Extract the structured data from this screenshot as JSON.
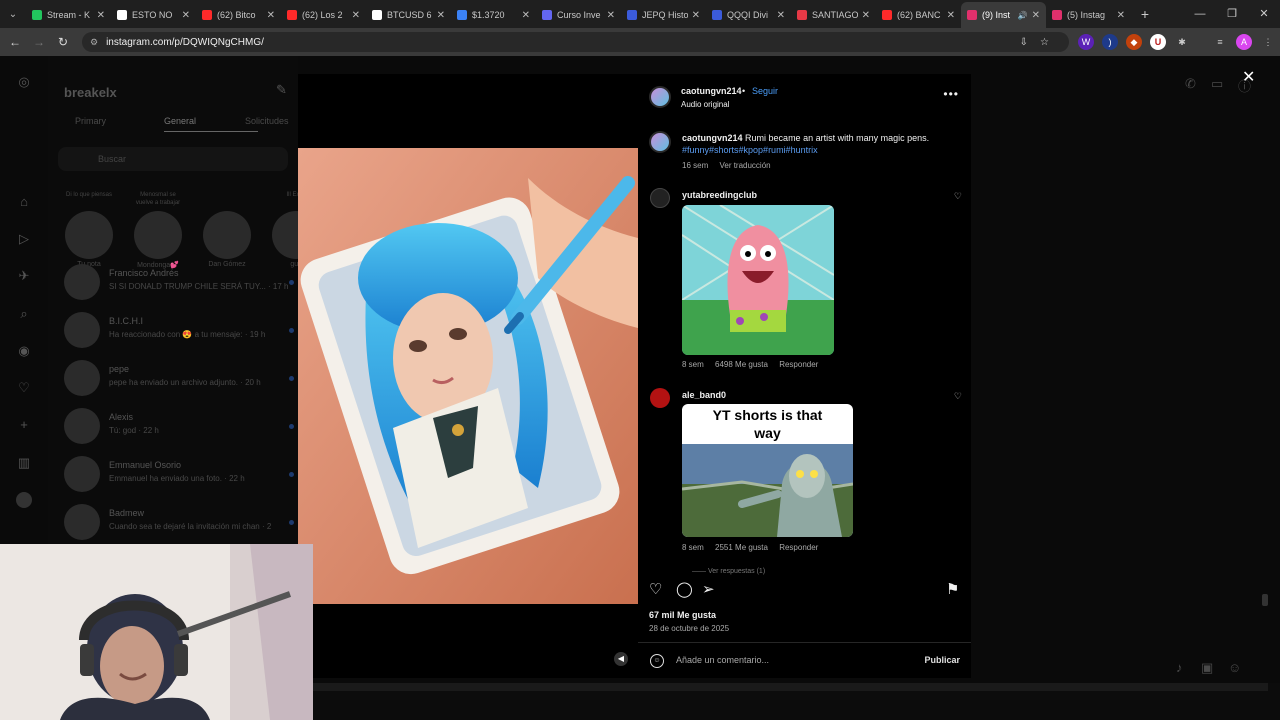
{
  "browser": {
    "tabs": [
      {
        "title": "Stream - K",
        "color": "#22c55e"
      },
      {
        "title": "ESTO NO",
        "color": "#ffffff"
      },
      {
        "title": "(62) Bitco",
        "color": "#ff2a2a"
      },
      {
        "title": "(62) Los 2",
        "color": "#ff2a2a"
      },
      {
        "title": "BTCUSD 6",
        "color": "#ffffff"
      },
      {
        "title": "$1.3720",
        "color": "#3b82f6"
      },
      {
        "title": "Curso Inve",
        "color": "#6366f1"
      },
      {
        "title": "JEPQ Histo",
        "color": "#3b5bdb"
      },
      {
        "title": "QQQI Divi",
        "color": "#3b5bdb"
      },
      {
        "title": "SANTIAGO",
        "color": "#e63946"
      },
      {
        "title": "(62) BANC",
        "color": "#ff2a2a"
      },
      {
        "title": "(9) Inst",
        "color": "#e1306c"
      },
      {
        "title": "(5) Instag",
        "color": "#e1306c"
      }
    ],
    "url": "instagram.com/p/DQWIQNgCHMG/"
  },
  "dm": {
    "username": "breakelx",
    "tabs": {
      "primary": "Primary",
      "general": "General",
      "requests": "Solicitudes"
    },
    "search_placeholder": "Buscar",
    "notes": [
      {
        "bubble": "Di lo que piensas",
        "name": "Tu nota"
      },
      {
        "bubble": "Menosmal se vuelve a trabajar",
        "name": "Mondonga💕"
      },
      {
        "bubble": "",
        "name": "Dan Gómez"
      },
      {
        "bubble": "Ill Expli",
        "name": "gus"
      }
    ],
    "chats": [
      {
        "name": "Francisco Andrés",
        "msg": "SI SI DONALD TRUMP CHILE SERÁ TUY... · 17 h"
      },
      {
        "name": "B.I.C.H.I",
        "msg": "Ha reaccionado con 😍 a tu mensaje: · 19 h"
      },
      {
        "name": "pepe",
        "msg": "pepe ha enviado un archivo adjunto. · 20 h"
      },
      {
        "name": "Alexis",
        "msg": "Tú: god · 22 h"
      },
      {
        "name": "Emmanuel Osorio",
        "msg": "Emmanuel ha enviado una foto. · 22 h"
      },
      {
        "name": "Badmew",
        "msg": "Cuando sea te dejaré la invitación mi chan · 2"
      }
    ]
  },
  "post": {
    "author": "caotungvn214",
    "follow": "Seguir",
    "audio": "Audio original",
    "caption_text": "Rumi became an artist with many magic pens.",
    "hashtags": "#funny#shorts#kpop#rumi#huntrix",
    "caption_age": "16 sem",
    "translate": "Ver traducción",
    "comments": [
      {
        "user": "yutabreedingclub",
        "age": "8 sem",
        "likes": "6498 Me gusta",
        "reply": "Responder"
      },
      {
        "user": "ale_band0",
        "age": "8 sem",
        "likes": "2551 Me gusta",
        "reply": "Responder",
        "meme_text": "YT shorts is that way"
      }
    ],
    "view_replies": "Ver respuestas (1)",
    "like_count": "67 mil Me gusta",
    "date": "28 de octubre de 2025",
    "comment_placeholder": "Añade un comentario...",
    "publish": "Publicar"
  }
}
